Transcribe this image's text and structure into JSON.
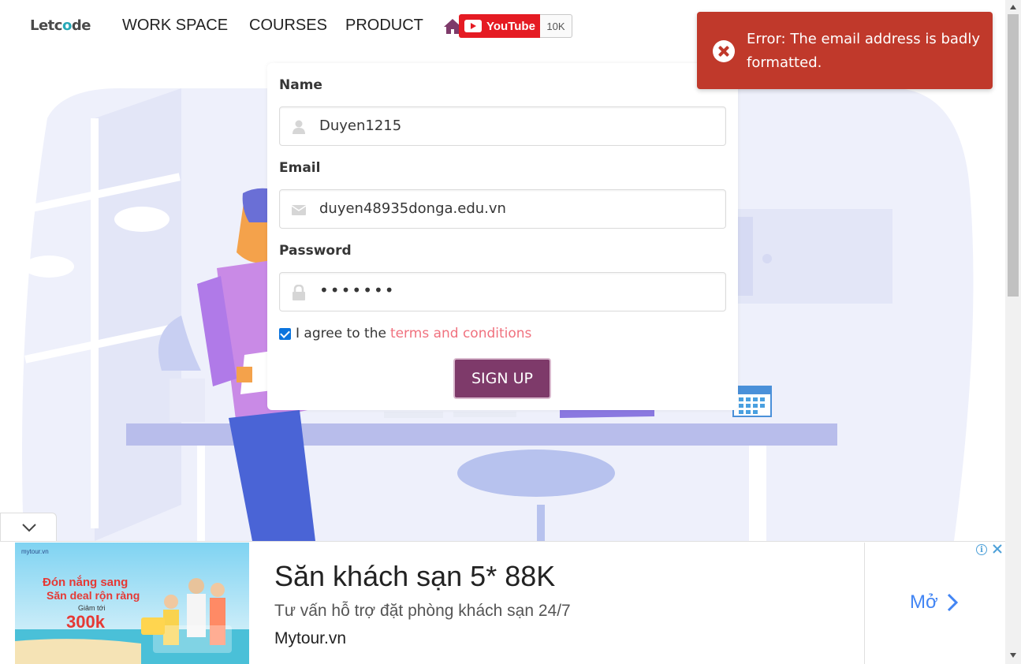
{
  "brand": {
    "logo_pre": "Letc",
    "logo_o": "o",
    "logo_post": "de"
  },
  "nav": {
    "workspace": "WORK SPACE",
    "courses": "COURSES",
    "product": "PRODUCT",
    "youtube_label": "YouTube",
    "youtube_count": "10K"
  },
  "form": {
    "name_label": "Name",
    "name_value": "Duyen1215",
    "email_label": "Email",
    "email_value": "duyen48935donga.edu.vn",
    "password_label": "Password",
    "password_value": "•••••••",
    "agree_text": "I agree to the",
    "terms_text": "terms and conditions",
    "agree_checked": true,
    "submit_label": "SIGN UP"
  },
  "toast": {
    "message": "Error: The email address is badly formatted."
  },
  "ad": {
    "headline": "Săn khách sạn 5* 88K",
    "description": "Tư vấn hỗ trợ đặt phòng khách sạn 24/7",
    "site": "Mytour.vn",
    "cta": "Mở",
    "banner_brand": "mytour.vn",
    "banner_line1": "Đón nắng sang",
    "banner_line2": "Săn deal rộn ràng",
    "banner_line3": "Giảm tới",
    "banner_amount": "300k"
  },
  "colors": {
    "toast_bg": "#c0392b",
    "button_bg": "#7e3a6a",
    "terms_link": "#f0717e",
    "youtube_red": "#e51b23",
    "ad_cta": "#4285f4"
  }
}
